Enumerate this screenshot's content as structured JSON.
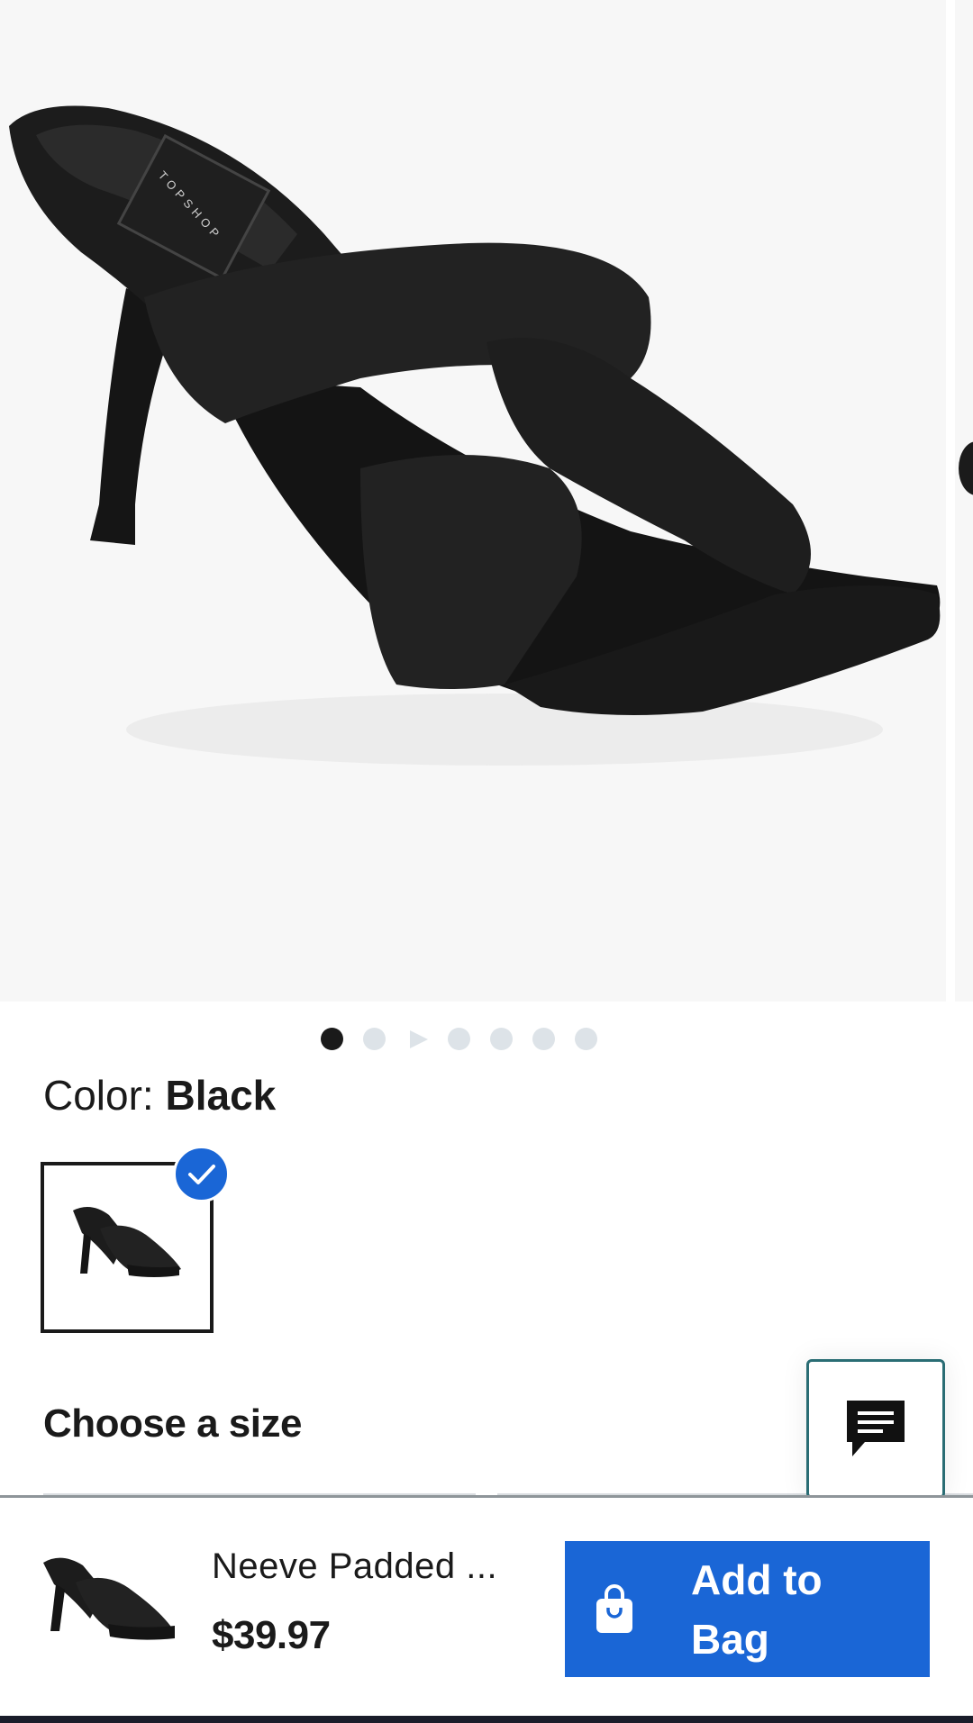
{
  "product": {
    "brand_stamp": "TOPSHOP",
    "name": "Neeve Padded ...",
    "price": "$39.97"
  },
  "carousel": {
    "total_slides": 7,
    "active_index": 0
  },
  "color": {
    "label": "Color: ",
    "value": "Black"
  },
  "size": {
    "title": "Choose a size"
  },
  "actions": {
    "add_to_bag": "Add to Bag"
  },
  "icons": {
    "chat": "chat-bubble-icon",
    "bag": "shopping-bag-icon",
    "check": "checkmark-icon"
  },
  "colors": {
    "accent": "#1a66d6",
    "chat_border": "#2a6d74",
    "text": "#1a1a1a"
  }
}
